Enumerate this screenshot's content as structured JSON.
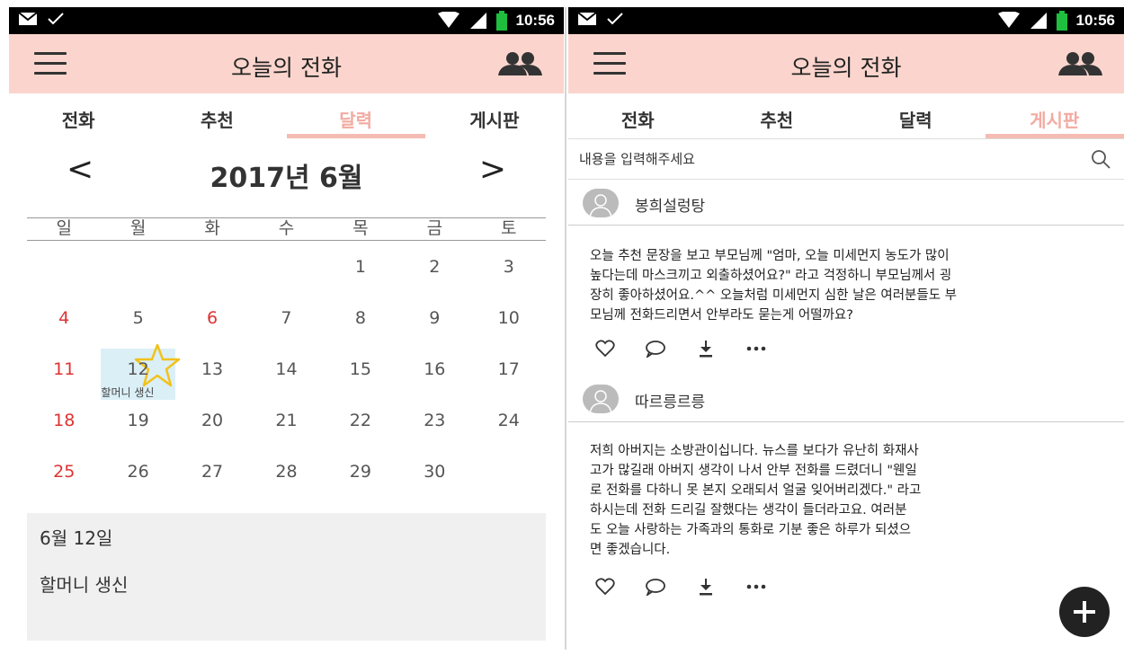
{
  "status_bar": {
    "time": "10:56"
  },
  "app": {
    "title": "오늘의 전화"
  },
  "tabs": [
    {
      "label": "전화"
    },
    {
      "label": "추천"
    },
    {
      "label": "달력"
    },
    {
      "label": "게시판"
    }
  ],
  "calendar": {
    "month_title": "2017년 6월",
    "prev_arrow": "<",
    "next_arrow": ">",
    "weekdays": [
      "일",
      "월",
      "화",
      "수",
      "목",
      "금",
      "토"
    ],
    "weeks": [
      [
        "",
        "",
        "",
        "",
        "1",
        "2",
        "3"
      ],
      [
        "4",
        "5",
        "6",
        "7",
        "8",
        "9",
        "10"
      ],
      [
        "11",
        "12",
        "13",
        "14",
        "15",
        "16",
        "17"
      ],
      [
        "18",
        "19",
        "20",
        "21",
        "22",
        "23",
        "24"
      ],
      [
        "25",
        "26",
        "27",
        "28",
        "29",
        "30",
        ""
      ]
    ],
    "red_days": [
      "4",
      "6",
      "11",
      "18",
      "25"
    ],
    "selected_day": "12",
    "event_label": "할머니 생신",
    "colors": {
      "holiday": "#dd3333",
      "selected_bg": "#dbeff7",
      "star": "#f2c21b"
    }
  },
  "detail": {
    "date": "6월 12일",
    "event": "할머니 생신"
  },
  "board": {
    "search_placeholder": "내용을 입력해주세요",
    "posts": [
      {
        "author": "봉희설렁탕",
        "body": "오늘 추천 문장을 보고 부모님께 \"엄마, 오늘 미세먼지 농도가 많이\n높다는데 마스크끼고 외출하셨어요?\" 라고 걱정하니 부모님께서 굉\n장히 좋아하셨어요.^^ 오늘처럼 미세먼지 심한 날은 여러분들도 부\n모님께 전화드리면서 안부라도 묻는게 어떨까요?"
      },
      {
        "author": "따르릉르릉",
        "body": "저희 아버지는 소방관이십니다. 뉴스를 보다가 유난히 화재사\n고가 많길래 아버지 생각이 나서 안부 전화를 드렸더니 \"웬일\n로 전화를 다하니 못 본지 오래되서 얼굴 잊어버리겠다.\" 라고\n하시는데 전화 드리길 잘했다는 생각이 들더라고요. 여러분\n도 오늘 사랑하는 가족과의 통화로 기분 좋은 하루가 되셨으\n면 좋겠습니다."
      }
    ]
  },
  "colors": {
    "appbar": "#fbd5cd",
    "active_tab": "#f3aaa1",
    "tab_indicator": "#f5bcb4"
  },
  "icons": {
    "menu": "hamburger-icon",
    "people": "people-icon",
    "search": "search-icon",
    "like": "heart-icon",
    "comment": "comment-icon",
    "download": "download-icon",
    "more": "more-icon",
    "add": "plus-icon"
  }
}
